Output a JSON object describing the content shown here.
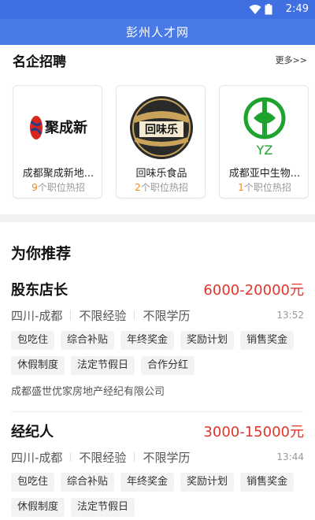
{
  "status": {
    "time": "2:49"
  },
  "app": {
    "title": "彭州人才网"
  },
  "famous": {
    "heading": "名企招聘",
    "more": "更多>>",
    "companies": [
      {
        "name": "成都聚成新地...",
        "count": "9",
        "jobs_suffix": "个职位热招",
        "logo_text": "聚成新"
      },
      {
        "name": "回味乐食品",
        "count": "2",
        "jobs_suffix": "个职位热招",
        "logo_text": "回味乐"
      },
      {
        "name": "成都亚中生物...",
        "count": "1",
        "jobs_suffix": "个职位热招",
        "logo_text": "YZ"
      }
    ]
  },
  "recommend": {
    "heading": "为你推荐",
    "jobs": [
      {
        "title": "股东店长",
        "salary": "6000-20000元",
        "location": "四川-成都",
        "experience": "不限经验",
        "education": "不限学历",
        "time": "13:52",
        "tags": [
          "包吃住",
          "综合补贴",
          "年终奖金",
          "奖励计划",
          "销售奖金",
          "休假制度",
          "法定节假日",
          "合作分红"
        ],
        "company": "成都盛世优家房地产经纪有限公司"
      },
      {
        "title": "经纪人",
        "salary": "3000-15000元",
        "location": "四川-成都",
        "experience": "不限经验",
        "education": "不限学历",
        "time": "13:44",
        "tags": [
          "包吃住",
          "综合补贴",
          "年终奖金",
          "奖励计划",
          "销售奖金",
          "休假制度",
          "法定节假日"
        ],
        "company": ""
      }
    ]
  },
  "colors": {
    "header": "#4a7ae6",
    "salary": "#e0352b",
    "count": "#f08a1c"
  }
}
